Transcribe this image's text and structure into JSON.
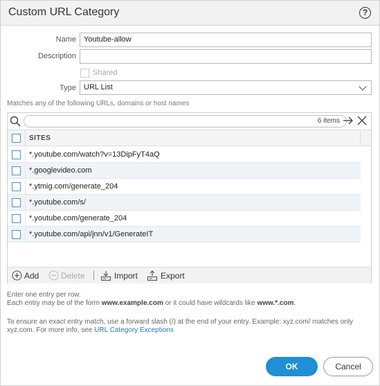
{
  "dialog": {
    "title": "Custom URL Category",
    "help_icon": "?"
  },
  "form": {
    "name_label": "Name",
    "name_value": "Youtube-allow",
    "description_label": "Description",
    "description_value": "",
    "shared_label": "Shared",
    "shared_checked": false,
    "type_label": "Type",
    "type_value": "URL List"
  },
  "sites": {
    "hint": "Matches any of the following URLs, domains or host names",
    "count": "6 items",
    "column_header": "SITES",
    "rows": [
      "*.youtube.com/watch?v=13DipFyT4aQ",
      "*.googlevideo.com",
      "*.ytmig.com/generate_204",
      "*.youtube.com/s/",
      "*.youtube.com/generate_204",
      "*.youtube.com/api/jnn/v1/GenerateIT"
    ],
    "toolbar": {
      "add": "Add",
      "delete": "Delete",
      "import": "Import",
      "export": "Export"
    }
  },
  "notes": {
    "line1": "Enter one entry per row.",
    "line2_prefix": "Each entry may be of the form ",
    "line2_example": "www.example.com",
    "line2_middle": " or it could have wildcards like ",
    "line2_wildcard": "www.*.com",
    "line2_suffix": ".",
    "line3": "To ensure an exact entry match, use a forward slash (/) at the end of your entry. Example: xyz.com/ matches only",
    "line4_prefix": "xyz.com. For more info, see ",
    "line4_link": "URL Category Exceptions"
  },
  "buttons": {
    "ok": "OK",
    "cancel": "Cancel"
  },
  "colors": {
    "accent": "#1f8fd6",
    "link": "#2a77b5",
    "row_alt": "#eef4f7"
  }
}
